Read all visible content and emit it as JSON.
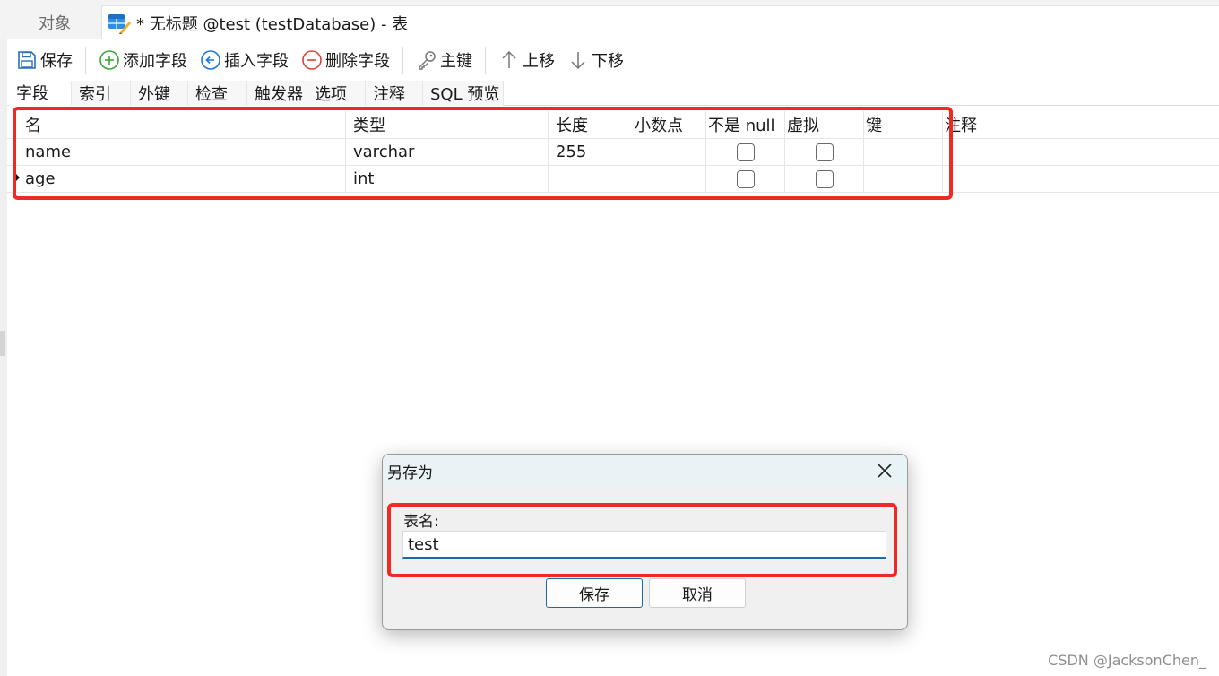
{
  "tabs": {
    "objects_label": "对象",
    "active_label": "* 无标题 @test (testDatabase) - 表"
  },
  "toolbar": {
    "save": "保存",
    "add_field": "添加字段",
    "insert_field": "插入字段",
    "delete_field": "删除字段",
    "primary_key": "主键",
    "move_up": "上移",
    "move_down": "下移"
  },
  "subtabs": [
    "字段",
    "索引",
    "外键",
    "检查",
    "触发器",
    "选项",
    "注释",
    "SQL 预览"
  ],
  "grid": {
    "columns": [
      "名",
      "类型",
      "长度",
      "小数点",
      "不是 null",
      "虚拟",
      "键",
      "注释"
    ],
    "rows": [
      {
        "name": "name",
        "type": "varchar",
        "length": "255",
        "decimal": "",
        "not_null": false,
        "virtual": false,
        "key": "",
        "comment": ""
      },
      {
        "name": "age",
        "type": "int",
        "length": "",
        "decimal": "",
        "not_null": false,
        "virtual": false,
        "key": "",
        "comment": ""
      }
    ]
  },
  "dialog": {
    "title": "另存为",
    "label": "表名:",
    "input_value": "test",
    "save_button": "保存",
    "cancel_button": "取消"
  },
  "watermark": "CSDN @JacksonChen_",
  "colors": {
    "highlight": "#ee2a24",
    "accent": "#1a6aa8",
    "add_green": "#3aa63a",
    "insert_blue": "#1e78d7",
    "delete_red": "#e0413a"
  }
}
